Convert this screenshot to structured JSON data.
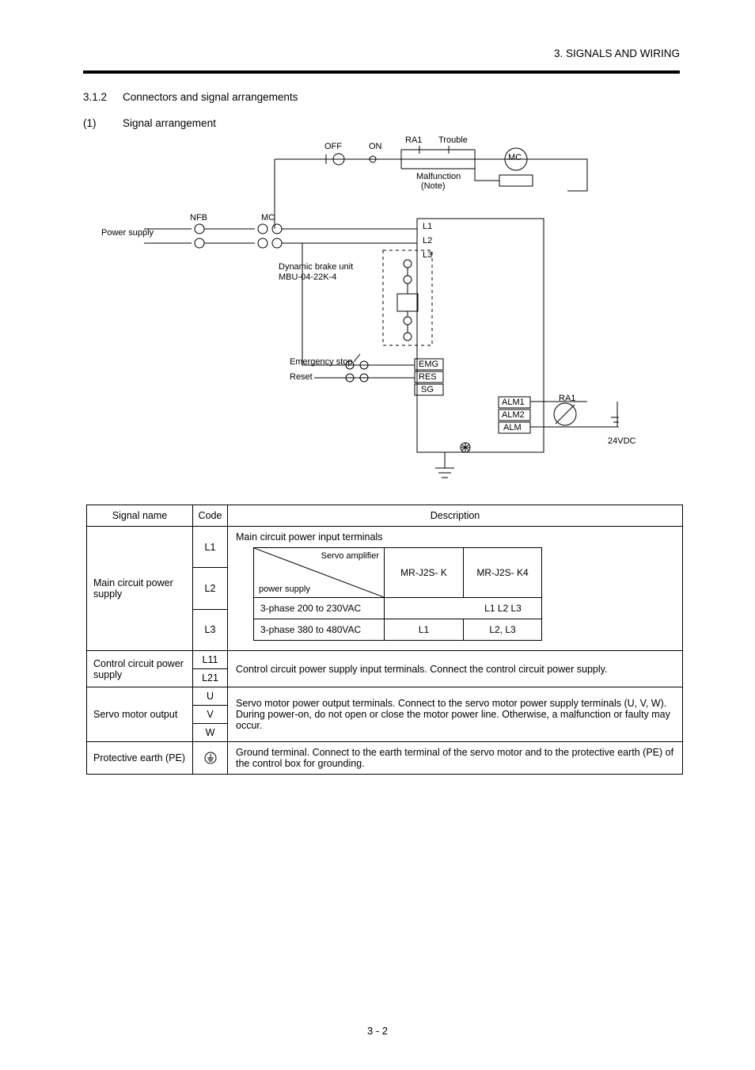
{
  "header": {
    "chapter": "3. SIGNALS AND WIRING"
  },
  "section": {
    "number": "3.1.2",
    "title": "Connectors and signal arrangements"
  },
  "intro": {
    "label": "(1)",
    "text": "Signal arrangement"
  },
  "diagram": {
    "ra1": "RA1",
    "trouble": "Trouble",
    "off": "OFF",
    "on": "ON",
    "som_note1": "Malfunction",
    "som_note2": "(Note)",
    "mc_right": "MC",
    "nfb": "NFB",
    "mc_left": "MC",
    "L1": "L1",
    "L2": "L2",
    "L3": "L3",
    "MBU_title": "Dynamic brake unit",
    "MBU": "MBU-04-22K-4",
    "EMG_btn": "Emergency stop",
    "RESET_btn": "Reset",
    "EMG_term": "EMG",
    "RES": "RES",
    "SG": "SG",
    "ALM1": "ALM1",
    "ALM2": "ALM2",
    "ALM": "ALM",
    "DC": "24VDC",
    "RA1b": "RA1",
    "power_note": "Power supply",
    "page_footnote": "3 -  2"
  },
  "table": {
    "head": {
      "c1": "Signal name",
      "c2": "Code",
      "c3": "Description"
    },
    "main_power": {
      "label": "Main circuit power supply",
      "codes": [
        "L1",
        "L2",
        "L3"
      ],
      "desc_lead": "Main circuit power input terminals",
      "inner": {
        "tr": "Servo amplifier",
        "bl": "power supply",
        "col2": "MR-J2S- K",
        "col3": "MR-J2S- K4",
        "r1": {
          "label": "3-phase 200 to 230VAC",
          "a": "L1  L2  L3",
          "b": ""
        },
        "r2": {
          "label": "3-phase 380 to 480VAC",
          "a": "L1",
          "b": "L2, L3"
        }
      }
    },
    "ctrl_power": {
      "label": "Control circuit power supply",
      "codes": [
        "L11",
        "L21"
      ],
      "desc": "Control circuit power supply input terminals. Connect the control circuit power supply."
    },
    "servo_out": {
      "label": "Servo motor output",
      "codes": [
        "U",
        "V",
        "W"
      ],
      "desc": "Servo motor power output terminals. Connect to the servo motor power supply terminals (U, V, W). During power-on, do not open or close the motor power line. Otherwise, a malfunction or faulty may occur."
    },
    "pe": {
      "label": "Protective earth (PE)",
      "desc": "Ground terminal.  Connect to the earth terminal of the servo motor and to the protective earth (PE) of the control box for grounding."
    }
  }
}
